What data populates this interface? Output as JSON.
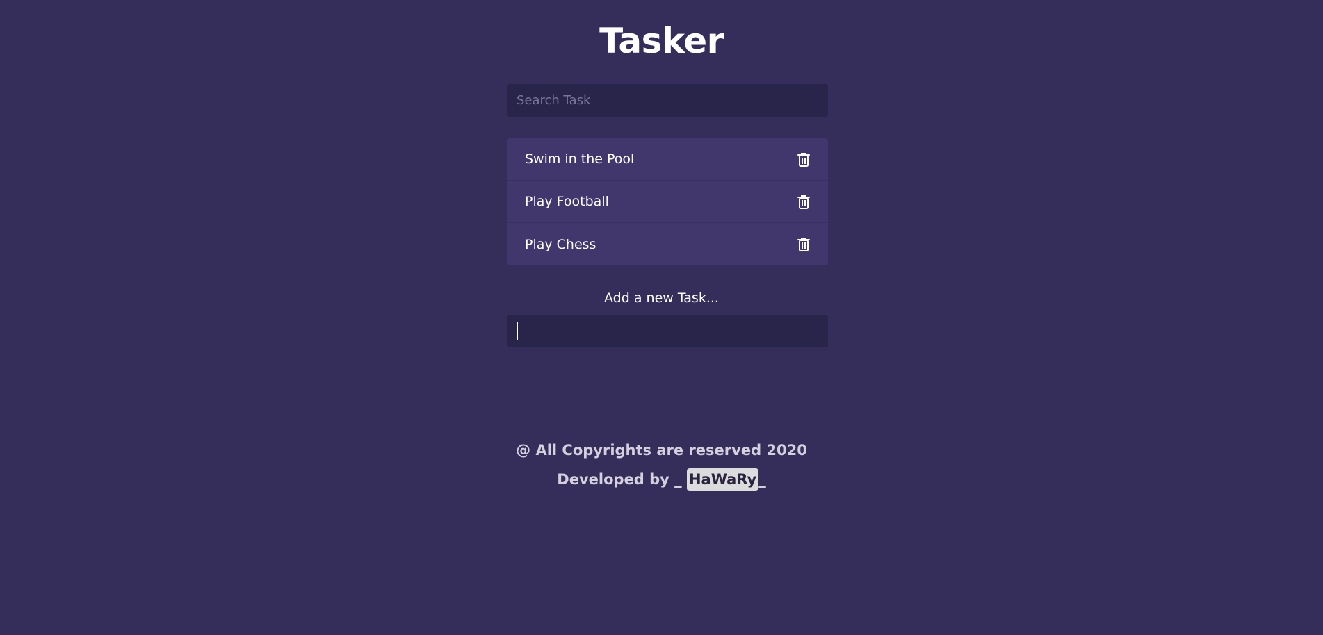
{
  "app": {
    "title": "Tasker"
  },
  "search": {
    "placeholder": "Search Task",
    "value": ""
  },
  "tasks": [
    {
      "label": "Swim in the Pool",
      "icon": "trash-icon"
    },
    {
      "label": "Play Football",
      "icon": "trash-icon"
    },
    {
      "label": "Play Chess",
      "icon": "trash-icon"
    }
  ],
  "add_task": {
    "label": "Add a new Task...",
    "value": ""
  },
  "footer": {
    "copyright": "@ All Copyrights are reserved 2020",
    "developed_prefix": "Developed by _ ",
    "developer_name": "HaWaRy",
    "developed_suffix": "_"
  },
  "colors": {
    "background": "#352e5b",
    "input_background": "#29244a",
    "list_background": "#41376c",
    "text": "#ffffff",
    "footer_text": "#d4d0dd",
    "name_highlight": "#dcdcdc"
  }
}
